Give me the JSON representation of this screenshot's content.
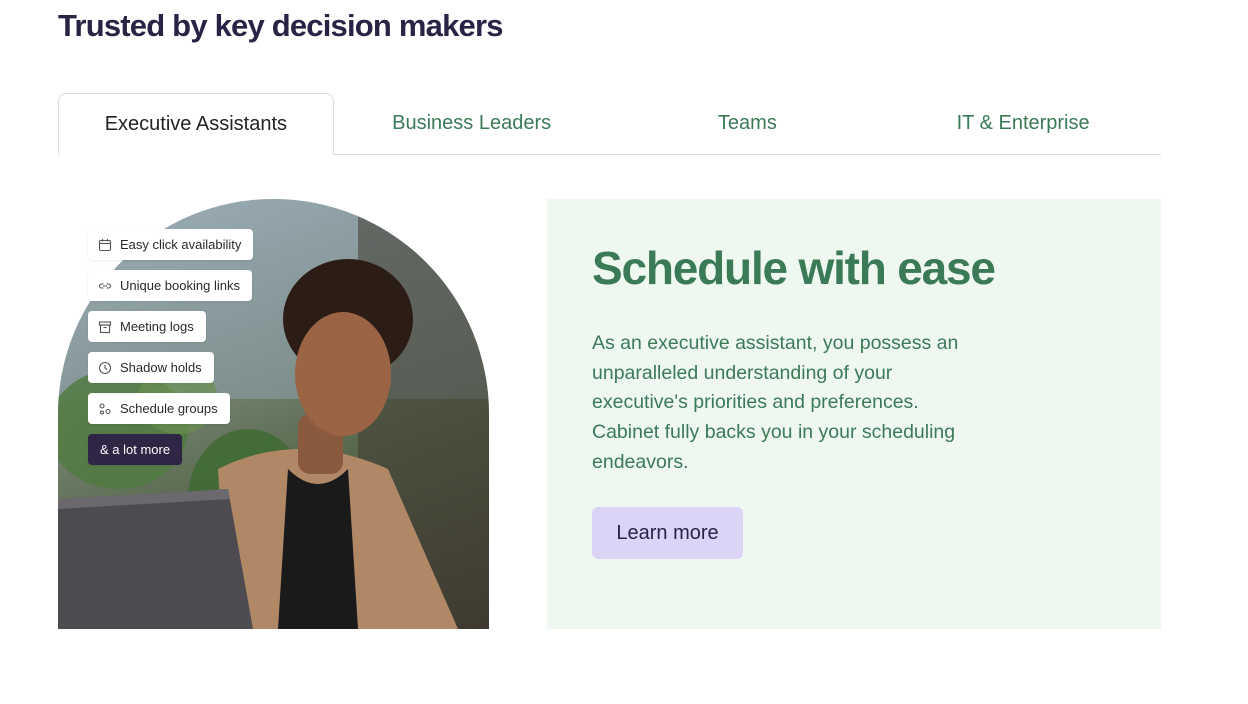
{
  "section": {
    "title": "Trusted by key decision makers"
  },
  "tabs": [
    {
      "label": "Executive Assistants",
      "active": true
    },
    {
      "label": "Business Leaders",
      "active": false
    },
    {
      "label": "Teams",
      "active": false
    },
    {
      "label": "IT & Enterprise",
      "active": false
    }
  ],
  "features": [
    {
      "label": "Easy click availability",
      "icon": "calendar-icon"
    },
    {
      "label": "Unique booking links",
      "icon": "link-icon"
    },
    {
      "label": "Meeting logs",
      "icon": "archive-icon"
    },
    {
      "label": "Shadow holds",
      "icon": "clock-icon"
    },
    {
      "label": "Schedule groups",
      "icon": "group-icon"
    },
    {
      "label": "& a lot more",
      "icon": ""
    }
  ],
  "card": {
    "title": "Schedule with ease",
    "text": "As an executive assistant, you possess an unparalleled understanding of your executive's priorities and preferences. Cabinet fully backs you in your scheduling endeavors.",
    "button_label": "Learn more"
  },
  "colors": {
    "heading": "#2a2346",
    "accent_green": "#3b7a57",
    "card_background": "#eef8f1",
    "button_background": "#dcd4f7",
    "dark_chip": "#2f2545"
  }
}
